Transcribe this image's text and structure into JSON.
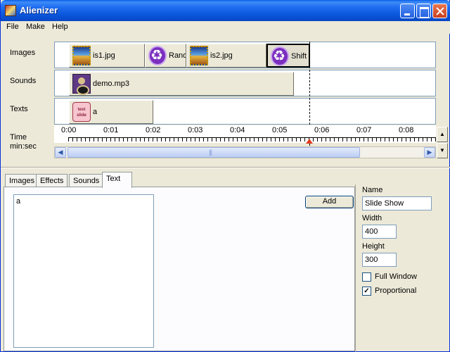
{
  "window": {
    "title": "Alienizer"
  },
  "menu": [
    "File",
    "Make",
    "Help"
  ],
  "timeline": {
    "row_labels": {
      "images": "Images",
      "sounds": "Sounds",
      "texts": "Texts",
      "time": "Time",
      "time_unit": "min:sec"
    },
    "image_clips": [
      {
        "label": "is1.jpg",
        "icon": "photo-icon"
      },
      {
        "label": "Rand",
        "icon": "recycle-icon"
      },
      {
        "label": "is2.jpg",
        "icon": "photo-icon"
      },
      {
        "label": "Shift",
        "icon": "recycle-icon"
      }
    ],
    "sound_clips": [
      {
        "label": "demo.mp3",
        "icon": "speaker-icon"
      }
    ],
    "text_clips": [
      {
        "label": "a",
        "icon": "text-slide-icon",
        "icon_text": "text slide"
      }
    ],
    "ruler_ticks": [
      "0:00",
      "0:01",
      "0:02",
      "0:03",
      "0:04",
      "0:05",
      "0:06",
      "0:07",
      "0:08"
    ]
  },
  "tabs": [
    "Images",
    "Effects",
    "Sounds",
    "Text"
  ],
  "active_tab": "Text",
  "text_panel": {
    "content": "a",
    "add_label": "Add"
  },
  "properties": {
    "name_label": "Name",
    "name_value": "Slide Show",
    "width_label": "Width",
    "width_value": "400",
    "height_label": "Height",
    "height_value": "300",
    "full_window_label": "Full Window",
    "full_window_checked": false,
    "proportional_label": "Proportional",
    "proportional_checked": true
  }
}
